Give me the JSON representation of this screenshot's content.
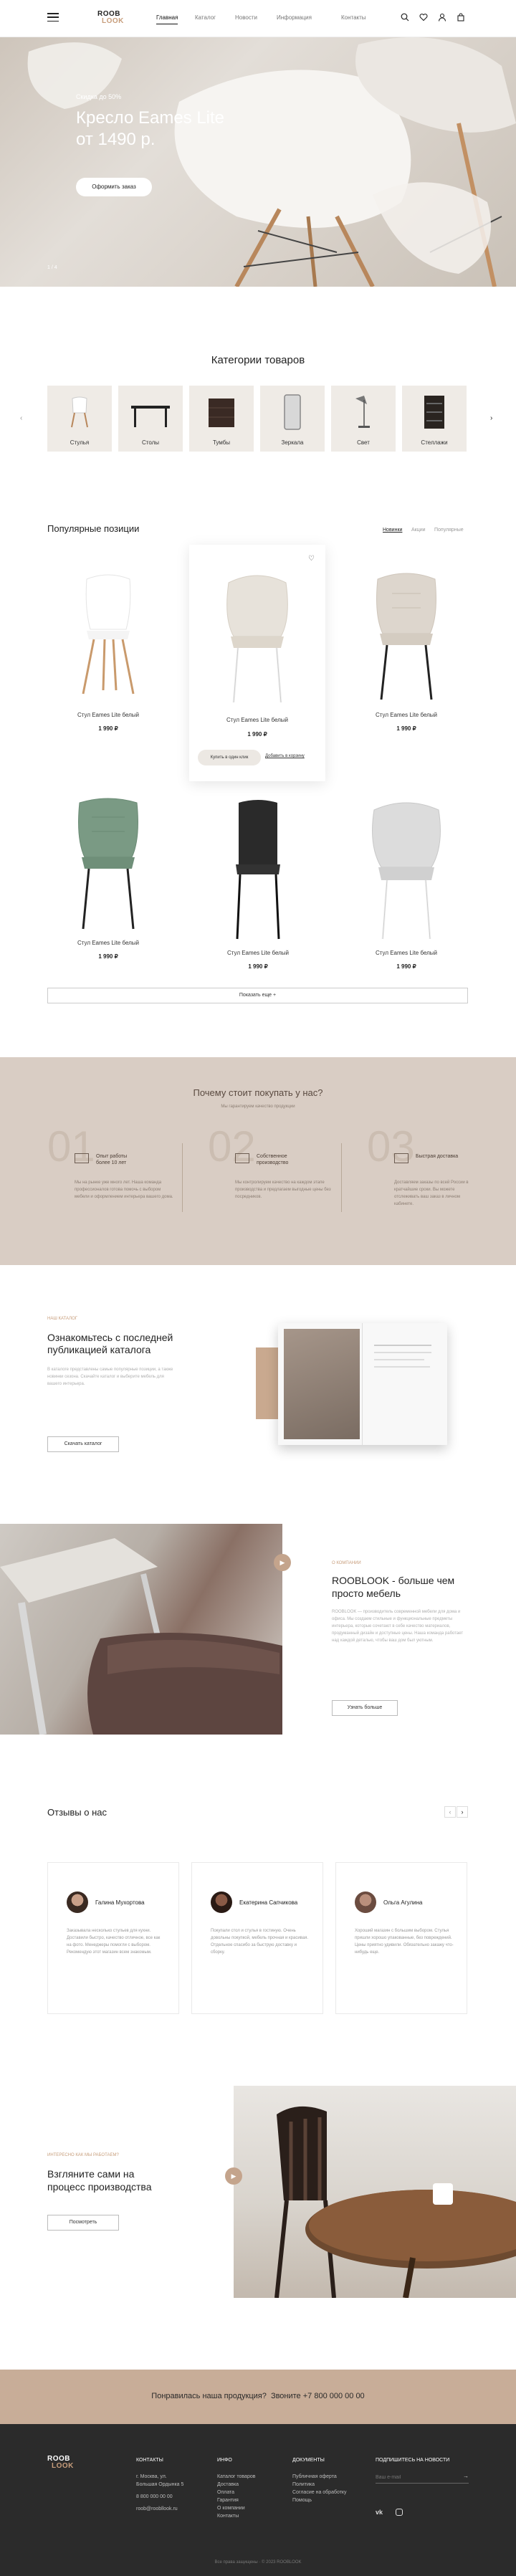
{
  "header": {
    "logo_top": "ROOB",
    "logo_bottom": "LOOK",
    "nav": [
      "Главная",
      "Каталог",
      "Новости",
      "Информация",
      "Контакты"
    ],
    "icons": [
      "search-icon",
      "heart-icon",
      "user-icon",
      "cart-icon"
    ]
  },
  "hero": {
    "discount": "Скидка до 50%",
    "title_line1": "Кресло Eames Lite",
    "title_line2": "от 1490 р.",
    "cta": "Оформить заказ",
    "pager": "1 / 4"
  },
  "categories": {
    "title": "Категории товаров",
    "items": [
      "Стулья",
      "Столы",
      "Тумбы",
      "Зеркала",
      "Свет",
      "Стеллажи"
    ]
  },
  "popular": {
    "title": "Популярные позиции",
    "tabs": [
      "Новинки",
      "Акции",
      "Популярные"
    ],
    "products": [
      {
        "name": "Стул Eames Lite белый",
        "price": "1 990 ₽"
      },
      {
        "name": "Стул Eames Lite белый",
        "price": "1 990 ₽",
        "add_to_cart": "Купить в один клик",
        "compare": "Добавить в корзину"
      },
      {
        "name": "Стул Eames Lite белый",
        "price": "1 990 ₽"
      },
      {
        "name": "Стул Eames Lite белый",
        "price": "1 990 ₽"
      },
      {
        "name": "Стул Eames Lite белый",
        "price": "1 990 ₽"
      },
      {
        "name": "Стул Eames Lite белый",
        "price": "1 990 ₽"
      }
    ],
    "more": "Показать еще"
  },
  "why": {
    "title": "Почему стоит покупать у нас?",
    "subtitle": "Мы гарантируем качество продукции",
    "items": [
      {
        "num": "01",
        "title": "Опыт работы более 10 лет",
        "text": "Мы на рынке уже много лет. Наша команда профессионалов готова помочь с выбором мебели и оформлением интерьера вашего дома."
      },
      {
        "num": "02",
        "title": "Собственное производство",
        "text": "Мы контролируем качество на каждом этапе производства и предлагаем выгодные цены без посредников."
      },
      {
        "num": "03",
        "title": "Быстрая доставка",
        "text": "Доставляем заказы по всей России в кратчайшие сроки. Вы можете отслеживать ваш заказ в личном кабинете."
      }
    ]
  },
  "catalog": {
    "kicker": "НАШ КАТАЛОГ",
    "title_line1": "Ознакомьтесь с последней",
    "title_line2": "публикацией каталога",
    "text": "В каталоге представлены самые популярные позиции, а также новинки сезона. Скачайте каталог и выберите мебель для вашего интерьера.",
    "button": "Скачать каталог"
  },
  "about": {
    "kicker": "О КОМПАНИИ",
    "title_line1": "ROOBLOOK - больше чем",
    "title_line2": "просто мебель",
    "text": "ROOBLOOK — производитель современной мебели для дома и офиса. Мы создаем стильные и функциональные предметы интерьера, которые сочетают в себе качество материалов, продуманный дизайн и доступные цены. Наша команда работает над каждой деталью, чтобы ваш дом был уютным.",
    "button": "Узнать больше"
  },
  "reviews": {
    "title": "Отзывы о нас",
    "items": [
      {
        "name": "Галина Мухортова",
        "text": "Заказывала несколько стульев для кухни. Доставили быстро, качество отличное, все как на фото. Менеджеры помогли с выбором. Рекомендую этот магазин всем знакомым."
      },
      {
        "name": "Екатерина Сапчикова",
        "text": "Покупали стол и стулья в гостиную. Очень довольны покупкой, мебель прочная и красивая. Отдельное спасибо за быструю доставку и сборку."
      },
      {
        "name": "Ольга Агулина",
        "text": "Хороший магазин с большим выбором. Стулья пришли хорошо упакованные, без повреждений. Цены приятно удивили. Обязательно закажу что-нибудь еще."
      }
    ]
  },
  "production": {
    "kicker": "ИНТЕРЕСНО КАК МЫ РАБОТАЕМ?",
    "title_line1": "Взгляните сами на",
    "title_line2": "процесс производства",
    "button": "Посмотреть"
  },
  "cta_bar": {
    "text": "Понравилась наша продукция?  Звоните +7 800 000 00 00"
  },
  "footer": {
    "contacts": {
      "title": "КОНТАКТЫ",
      "lines": [
        "г. Москва, ул.",
        "Большая Ордынка 5",
        "8 800 000 00 00",
        "roob@roobllook.ru"
      ]
    },
    "info": {
      "title": "ИНФО",
      "lines": [
        "Каталог товаров",
        "Доставка",
        "Оплата",
        "Гарантия",
        "О компании",
        "Контакты"
      ]
    },
    "documents": {
      "title": "ДОКУМЕНТЫ",
      "lines": [
        "Публичная оферта",
        "Политика",
        "Согласие на обработку",
        "Помощь"
      ]
    },
    "subscribe": {
      "title": "ПОДПИШИТЕСЬ НА НОВОСТИ",
      "placeholder": "Ваш e-mail"
    },
    "copyright": "Все права защищены · © 2023 ROOBLOOK"
  },
  "colors": {
    "accent": "#c79d7b",
    "beige": "#d9cdc4",
    "footer": "#2b2b2b",
    "cta": "#c8ad98"
  }
}
